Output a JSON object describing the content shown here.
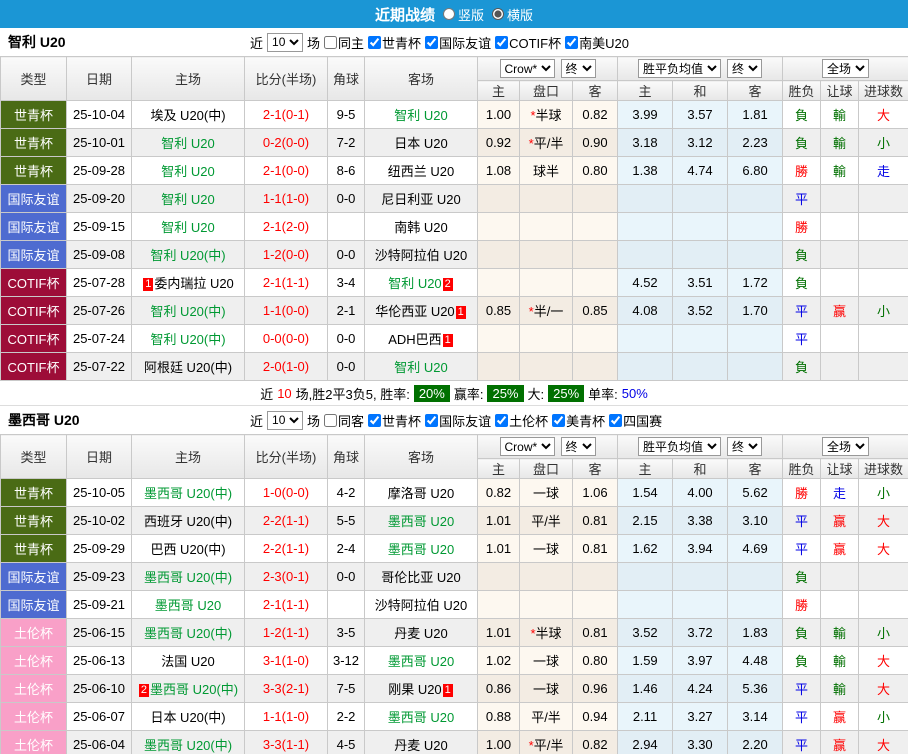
{
  "topbar": {
    "title": "近期战绩",
    "radio_vertical": "竖版",
    "radio_horizontal": "横版",
    "selected": "横版"
  },
  "table": {
    "col_headers": [
      "类型",
      "日期",
      "主场",
      "比分(半场)",
      "角球",
      "客场"
    ],
    "sub_headers": [
      "主",
      "盘口",
      "客",
      "主",
      "和",
      "客",
      "胜负",
      "让球",
      "进球数"
    ],
    "selects": {
      "bookmaker": "Crow*",
      "odds_stage": "终",
      "mean": "胜平负均值",
      "mean_stage": "终",
      "scope": "全场"
    }
  },
  "colors": {
    "topbar_bg": "#1B96D5",
    "type_world_youth_cup": "#4A6B15",
    "type_intl_friendly": "#4E6BD0",
    "type_cotif_cup": "#9D0D38",
    "type_toulon_cup": "#F9A0C8",
    "team_green": "#009933",
    "score_red": "#FF0000",
    "win_red": "#FF0000",
    "draw_blue": "#0000E6",
    "lose_green": "#007000",
    "pct_badge_bg": "#007000",
    "red_card_badge_bg": "#FF0000"
  },
  "sections": [
    {
      "team": "智利 U20",
      "filter": {
        "near": "近",
        "count": "10",
        "games": "场",
        "same": {
          "label": "同主",
          "checked": false
        },
        "comps": [
          {
            "label": "世青杯",
            "checked": true
          },
          {
            "label": "国际友谊",
            "checked": true
          },
          {
            "label": "COTIF杯",
            "checked": true
          },
          {
            "label": "南美U20",
            "checked": true
          }
        ]
      },
      "summary": {
        "near": "近",
        "count": "10",
        "record": "场,胜2平3负5, 胜率:",
        "win_rate": "20%",
        "odds_label": "赢率:",
        "odds_rate": "25%",
        "big_label": "大:",
        "big_rate": "25%",
        "single_label": "单率:",
        "single_rate": "50%"
      },
      "rows": [
        {
          "type_key": "wyc",
          "type": "世青杯",
          "date": "25-10-04",
          "home": {
            "text": "埃及 U20(中)",
            "green": false,
            "badge_pre": "",
            "badge_post": ""
          },
          "score": "2-1(0-1)",
          "corner": "9-5",
          "away": {
            "text": "智利 U20",
            "green": true,
            "badge_pre": "",
            "badge_post": ""
          },
          "odds_home": "1.00",
          "line": "半球",
          "line_star": true,
          "odds_away": "0.82",
          "mean_home": "3.99",
          "mean_draw": "3.57",
          "mean_away": "1.81",
          "wdl": "負",
          "wdl_c": "green",
          "let": "輸",
          "let_c": "green",
          "goal": "大",
          "goal_c": "red"
        },
        {
          "type_key": "wyc",
          "type": "世青杯",
          "date": "25-10-01",
          "home": {
            "text": "智利 U20",
            "green": true,
            "badge_pre": "",
            "badge_post": ""
          },
          "score": "0-2(0-0)",
          "corner": "7-2",
          "away": {
            "text": "日本 U20",
            "green": false,
            "badge_pre": "",
            "badge_post": ""
          },
          "odds_home": "0.92",
          "line": "平/半",
          "line_star": true,
          "odds_away": "0.90",
          "mean_home": "3.18",
          "mean_draw": "3.12",
          "mean_away": "2.23",
          "wdl": "負",
          "wdl_c": "green",
          "let": "輸",
          "let_c": "green",
          "goal": "小",
          "goal_c": "green"
        },
        {
          "type_key": "wyc",
          "type": "世青杯",
          "date": "25-09-28",
          "home": {
            "text": "智利 U20",
            "green": true,
            "badge_pre": "",
            "badge_post": ""
          },
          "score": "2-1(0-0)",
          "corner": "8-6",
          "away": {
            "text": "纽西兰 U20",
            "green": false,
            "badge_pre": "",
            "badge_post": ""
          },
          "odds_home": "1.08",
          "line": "球半",
          "line_star": false,
          "odds_away": "0.80",
          "mean_home": "1.38",
          "mean_draw": "4.74",
          "mean_away": "6.80",
          "wdl": "勝",
          "wdl_c": "red",
          "let": "輸",
          "let_c": "green",
          "goal": "走",
          "goal_c": "blue"
        },
        {
          "type_key": "gjyy",
          "type": "国际友谊",
          "date": "25-09-20",
          "home": {
            "text": "智利 U20",
            "green": true,
            "badge_pre": "",
            "badge_post": ""
          },
          "score": "1-1(1-0)",
          "corner": "0-0",
          "away": {
            "text": "尼日利亚 U20",
            "green": false,
            "badge_pre": "",
            "badge_post": ""
          },
          "odds_home": "",
          "line": "",
          "line_star": false,
          "odds_away": "",
          "mean_home": "",
          "mean_draw": "",
          "mean_away": "",
          "wdl": "平",
          "wdl_c": "blue",
          "let": "",
          "let_c": "",
          "goal": "",
          "goal_c": ""
        },
        {
          "type_key": "gjyy",
          "type": "国际友谊",
          "date": "25-09-15",
          "home": {
            "text": "智利 U20",
            "green": true,
            "badge_pre": "",
            "badge_post": ""
          },
          "score": "2-1(2-0)",
          "corner": "",
          "away": {
            "text": "南韩 U20",
            "green": false,
            "badge_pre": "",
            "badge_post": ""
          },
          "odds_home": "",
          "line": "",
          "line_star": false,
          "odds_away": "",
          "mean_home": "",
          "mean_draw": "",
          "mean_away": "",
          "wdl": "勝",
          "wdl_c": "red",
          "let": "",
          "let_c": "",
          "goal": "",
          "goal_c": ""
        },
        {
          "type_key": "gjyy",
          "type": "国际友谊",
          "date": "25-09-08",
          "home": {
            "text": "智利 U20(中)",
            "green": true,
            "badge_pre": "",
            "badge_post": ""
          },
          "score": "1-2(0-0)",
          "corner": "0-0",
          "away": {
            "text": "沙特阿拉伯 U20",
            "green": false,
            "badge_pre": "",
            "badge_post": ""
          },
          "odds_home": "",
          "line": "",
          "line_star": false,
          "odds_away": "",
          "mean_home": "",
          "mean_draw": "",
          "mean_away": "",
          "wdl": "負",
          "wdl_c": "green",
          "let": "",
          "let_c": "",
          "goal": "",
          "goal_c": ""
        },
        {
          "type_key": "cotif",
          "type": "COTIF杯",
          "date": "25-07-28",
          "home": {
            "text": "委内瑞拉 U20",
            "green": false,
            "badge_pre": "1",
            "badge_post": ""
          },
          "score": "2-1(1-1)",
          "corner": "3-4",
          "away": {
            "text": "智利 U20",
            "green": true,
            "badge_pre": "",
            "badge_post": "2"
          },
          "odds_home": "",
          "line": "",
          "line_star": false,
          "odds_away": "",
          "mean_home": "4.52",
          "mean_draw": "3.51",
          "mean_away": "1.72",
          "wdl": "負",
          "wdl_c": "green",
          "let": "",
          "let_c": "",
          "goal": "",
          "goal_c": ""
        },
        {
          "type_key": "cotif",
          "type": "COTIF杯",
          "date": "25-07-26",
          "home": {
            "text": "智利 U20(中)",
            "green": true,
            "badge_pre": "",
            "badge_post": ""
          },
          "score": "1-1(0-0)",
          "corner": "2-1",
          "away": {
            "text": "华伦西亚 U20",
            "green": false,
            "badge_pre": "",
            "badge_post": "1"
          },
          "odds_home": "0.85",
          "line": "半/一",
          "line_star": true,
          "odds_away": "0.85",
          "mean_home": "4.08",
          "mean_draw": "3.52",
          "mean_away": "1.70",
          "wdl": "平",
          "wdl_c": "blue",
          "let": "赢",
          "let_c": "red",
          "goal": "小",
          "goal_c": "green"
        },
        {
          "type_key": "cotif",
          "type": "COTIF杯",
          "date": "25-07-24",
          "home": {
            "text": "智利 U20(中)",
            "green": true,
            "badge_pre": "",
            "badge_post": ""
          },
          "score": "0-0(0-0)",
          "corner": "0-0",
          "away": {
            "text": "ADH巴西",
            "green": false,
            "badge_pre": "",
            "badge_post": "1"
          },
          "odds_home": "",
          "line": "",
          "line_star": false,
          "odds_away": "",
          "mean_home": "",
          "mean_draw": "",
          "mean_away": "",
          "wdl": "平",
          "wdl_c": "blue",
          "let": "",
          "let_c": "",
          "goal": "",
          "goal_c": ""
        },
        {
          "type_key": "cotif",
          "type": "COTIF杯",
          "date": "25-07-22",
          "home": {
            "text": "阿根廷 U20(中)",
            "green": false,
            "badge_pre": "",
            "badge_post": ""
          },
          "score": "2-0(1-0)",
          "corner": "0-0",
          "away": {
            "text": "智利 U20",
            "green": true,
            "badge_pre": "",
            "badge_post": ""
          },
          "odds_home": "",
          "line": "",
          "line_star": false,
          "odds_away": "",
          "mean_home": "",
          "mean_draw": "",
          "mean_away": "",
          "wdl": "負",
          "wdl_c": "green",
          "let": "",
          "let_c": "",
          "goal": "",
          "goal_c": ""
        }
      ]
    },
    {
      "team": "墨西哥 U20",
      "filter": {
        "near": "近",
        "count": "10",
        "games": "场",
        "same": {
          "label": "同客",
          "checked": false
        },
        "comps": [
          {
            "label": "世青杯",
            "checked": true
          },
          {
            "label": "国际友谊",
            "checked": true
          },
          {
            "label": "土伦杯",
            "checked": true
          },
          {
            "label": "美青杯",
            "checked": true
          },
          {
            "label": "四国赛",
            "checked": true
          }
        ]
      },
      "rows": [
        {
          "type_key": "wyc",
          "type": "世青杯",
          "date": "25-10-05",
          "home": {
            "text": "墨西哥 U20(中)",
            "green": true,
            "badge_pre": "",
            "badge_post": ""
          },
          "score": "1-0(0-0)",
          "corner": "4-2",
          "away": {
            "text": "摩洛哥 U20",
            "green": false,
            "badge_pre": "",
            "badge_post": ""
          },
          "odds_home": "0.82",
          "line": "一球",
          "line_star": false,
          "odds_away": "1.06",
          "mean_home": "1.54",
          "mean_draw": "4.00",
          "mean_away": "5.62",
          "wdl": "勝",
          "wdl_c": "red",
          "let": "走",
          "let_c": "blue",
          "goal": "小",
          "goal_c": "green"
        },
        {
          "type_key": "wyc",
          "type": "世青杯",
          "date": "25-10-02",
          "home": {
            "text": "西班牙 U20(中)",
            "green": false,
            "badge_pre": "",
            "badge_post": ""
          },
          "score": "2-2(1-1)",
          "corner": "5-5",
          "away": {
            "text": "墨西哥 U20",
            "green": true,
            "badge_pre": "",
            "badge_post": ""
          },
          "odds_home": "1.01",
          "line": "平/半",
          "line_star": false,
          "odds_away": "0.81",
          "mean_home": "2.15",
          "mean_draw": "3.38",
          "mean_away": "3.10",
          "wdl": "平",
          "wdl_c": "blue",
          "let": "赢",
          "let_c": "red",
          "goal": "大",
          "goal_c": "red"
        },
        {
          "type_key": "wyc",
          "type": "世青杯",
          "date": "25-09-29",
          "home": {
            "text": "巴西 U20(中)",
            "green": false,
            "badge_pre": "",
            "badge_post": ""
          },
          "score": "2-2(1-1)",
          "corner": "2-4",
          "away": {
            "text": "墨西哥 U20",
            "green": true,
            "badge_pre": "",
            "badge_post": ""
          },
          "odds_home": "1.01",
          "line": "一球",
          "line_star": false,
          "odds_away": "0.81",
          "mean_home": "1.62",
          "mean_draw": "3.94",
          "mean_away": "4.69",
          "wdl": "平",
          "wdl_c": "blue",
          "let": "赢",
          "let_c": "red",
          "goal": "大",
          "goal_c": "red"
        },
        {
          "type_key": "gjyy",
          "type": "国际友谊",
          "date": "25-09-23",
          "home": {
            "text": "墨西哥 U20(中)",
            "green": true,
            "badge_pre": "",
            "badge_post": ""
          },
          "score": "2-3(0-1)",
          "corner": "0-0",
          "away": {
            "text": "哥伦比亚 U20",
            "green": false,
            "badge_pre": "",
            "badge_post": ""
          },
          "odds_home": "",
          "line": "",
          "line_star": false,
          "odds_away": "",
          "mean_home": "",
          "mean_draw": "",
          "mean_away": "",
          "wdl": "負",
          "wdl_c": "green",
          "let": "",
          "let_c": "",
          "goal": "",
          "goal_c": ""
        },
        {
          "type_key": "gjyy",
          "type": "国际友谊",
          "date": "25-09-21",
          "home": {
            "text": "墨西哥 U20",
            "green": true,
            "badge_pre": "",
            "badge_post": ""
          },
          "score": "2-1(1-1)",
          "corner": "",
          "away": {
            "text": "沙特阿拉伯 U20",
            "green": false,
            "badge_pre": "",
            "badge_post": ""
          },
          "odds_home": "",
          "line": "",
          "line_star": false,
          "odds_away": "",
          "mean_home": "",
          "mean_draw": "",
          "mean_away": "",
          "wdl": "勝",
          "wdl_c": "red",
          "let": "",
          "let_c": "",
          "goal": "",
          "goal_c": ""
        },
        {
          "type_key": "tlb",
          "type": "土伦杯",
          "date": "25-06-15",
          "home": {
            "text": "墨西哥 U20(中)",
            "green": true,
            "badge_pre": "",
            "badge_post": ""
          },
          "score": "1-2(1-1)",
          "corner": "3-5",
          "away": {
            "text": "丹麦 U20",
            "green": false,
            "badge_pre": "",
            "badge_post": ""
          },
          "odds_home": "1.01",
          "line": "半球",
          "line_star": true,
          "odds_away": "0.81",
          "mean_home": "3.52",
          "mean_draw": "3.72",
          "mean_away": "1.83",
          "wdl": "負",
          "wdl_c": "green",
          "let": "輸",
          "let_c": "green",
          "goal": "小",
          "goal_c": "green"
        },
        {
          "type_key": "tlb",
          "type": "土伦杯",
          "date": "25-06-13",
          "home": {
            "text": "法国 U20",
            "green": false,
            "badge_pre": "",
            "badge_post": ""
          },
          "score": "3-1(1-0)",
          "corner": "3-12",
          "away": {
            "text": "墨西哥 U20",
            "green": true,
            "badge_pre": "",
            "badge_post": ""
          },
          "odds_home": "1.02",
          "line": "一球",
          "line_star": false,
          "odds_away": "0.80",
          "mean_home": "1.59",
          "mean_draw": "3.97",
          "mean_away": "4.48",
          "wdl": "負",
          "wdl_c": "green",
          "let": "輸",
          "let_c": "green",
          "goal": "大",
          "goal_c": "red"
        },
        {
          "type_key": "tlb",
          "type": "土伦杯",
          "date": "25-06-10",
          "home": {
            "text": "墨西哥 U20(中)",
            "green": true,
            "badge_pre": "2",
            "badge_post": ""
          },
          "score": "3-3(2-1)",
          "corner": "7-5",
          "away": {
            "text": "刚果 U20",
            "green": false,
            "badge_pre": "",
            "badge_post": "1"
          },
          "odds_home": "0.86",
          "line": "一球",
          "line_star": false,
          "odds_away": "0.96",
          "mean_home": "1.46",
          "mean_draw": "4.24",
          "mean_away": "5.36",
          "wdl": "平",
          "wdl_c": "blue",
          "let": "輸",
          "let_c": "green",
          "goal": "大",
          "goal_c": "red"
        },
        {
          "type_key": "tlb",
          "type": "土伦杯",
          "date": "25-06-07",
          "home": {
            "text": "日本 U20(中)",
            "green": false,
            "badge_pre": "",
            "badge_post": ""
          },
          "score": "1-1(1-0)",
          "corner": "2-2",
          "away": {
            "text": "墨西哥 U20",
            "green": true,
            "badge_pre": "",
            "badge_post": ""
          },
          "odds_home": "0.88",
          "line": "平/半",
          "line_star": false,
          "odds_away": "0.94",
          "mean_home": "2.11",
          "mean_draw": "3.27",
          "mean_away": "3.14",
          "wdl": "平",
          "wdl_c": "blue",
          "let": "赢",
          "let_c": "red",
          "goal": "小",
          "goal_c": "green"
        },
        {
          "type_key": "tlb",
          "type": "土伦杯",
          "date": "25-06-04",
          "home": {
            "text": "墨西哥 U20(中)",
            "green": true,
            "badge_pre": "",
            "badge_post": ""
          },
          "score": "3-3(1-1)",
          "corner": "4-5",
          "away": {
            "text": "丹麦 U20",
            "green": false,
            "badge_pre": "",
            "badge_post": ""
          },
          "odds_home": "1.00",
          "line": "平/半",
          "line_star": true,
          "odds_away": "0.82",
          "mean_home": "2.94",
          "mean_draw": "3.30",
          "mean_away": "2.20",
          "wdl": "平",
          "wdl_c": "blue",
          "let": "赢",
          "let_c": "red",
          "goal": "大",
          "goal_c": "red"
        }
      ]
    }
  ]
}
